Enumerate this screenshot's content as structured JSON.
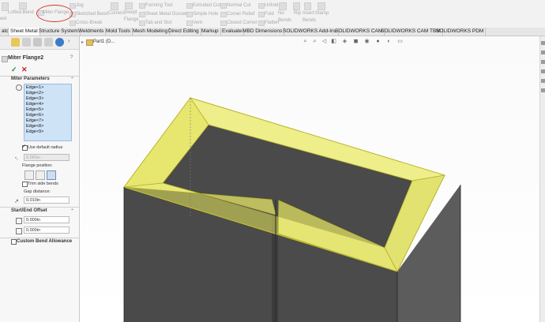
{
  "ribbon": {
    "tools": [
      {
        "id": "base-flange",
        "label": "eet"
      },
      {
        "id": "lofted-bend",
        "label": "Lofted-Bend"
      },
      {
        "id": "miter-flange",
        "label": "Miter Flange"
      },
      {
        "id": "jog",
        "label": "Jog"
      },
      {
        "id": "sketched-bend",
        "label": "Sketched Bend"
      },
      {
        "id": "cross-break",
        "label": "Cross-Break"
      },
      {
        "id": "corners",
        "label": "Corners"
      },
      {
        "id": "swept-flange",
        "label": "Swept Flange"
      },
      {
        "id": "forming-tool",
        "label": "Forming Tool"
      },
      {
        "id": "sheet-metal-gusset",
        "label": "Sheet Metal Gusset"
      },
      {
        "id": "tab-and-slot",
        "label": "Tab and Slot"
      },
      {
        "id": "extruded-cut",
        "label": "Extruded Cut"
      },
      {
        "id": "simple-hole",
        "label": "Simple Hole"
      },
      {
        "id": "vent",
        "label": "Vent"
      },
      {
        "id": "normal-cut",
        "label": "Normal Cut"
      },
      {
        "id": "corner-relief",
        "label": "Corner Relief"
      },
      {
        "id": "closed-corner",
        "label": "Closed Corner"
      },
      {
        "id": "unfold",
        "label": "Unfold"
      },
      {
        "id": "fold",
        "label": "Fold"
      },
      {
        "id": "flatten",
        "label": "Flatten"
      },
      {
        "id": "no-bends",
        "label": "No Bends"
      },
      {
        "id": "rip",
        "label": "Rip"
      },
      {
        "id": "insert-bends",
        "label": "Insert Bends"
      },
      {
        "id": "stamp",
        "label": "Stamp"
      }
    ]
  },
  "tabs": [
    {
      "label": "atch"
    },
    {
      "label": "Sheet Metal"
    },
    {
      "label": "Structure System"
    },
    {
      "label": "Weldments"
    },
    {
      "label": "Mold Tools"
    },
    {
      "label": "Mesh Modeling"
    },
    {
      "label": "Direct Editing"
    },
    {
      "label": "Markup"
    },
    {
      "label": "Evaluate"
    },
    {
      "label": "MBD Dimensions"
    },
    {
      "label": "SOLIDWORKS Add-Ins"
    },
    {
      "label": "SOLIDWORKS CAM"
    },
    {
      "label": "SOLIDWORKS CAM TBM"
    },
    {
      "label": "SOLIDWORKS PDM"
    }
  ],
  "panel": {
    "title": "Miter Flange2",
    "miter_section": "Miter Parameters",
    "edges": [
      "Edge<1>",
      "Edge<2>",
      "Edge<3>",
      "Edge<4>",
      "Edge<5>",
      "Edge<6>",
      "Edge<7>",
      "Edge<8>",
      "Edge<9>"
    ],
    "use_default_radius": "Use default radius",
    "radius_value": "0.065in",
    "flange_position_label": "Flange position:",
    "trim_side_bends": "Trim side bends",
    "gap_distance_label": "Gap distance:",
    "gap_value": "0.010in",
    "start_end_section": "Start/End Offset",
    "start_offset": "0.000in",
    "end_offset": "0.000in",
    "custom_bend_section": "Custom Bend Allowance",
    "ok_symbol": "✓",
    "cancel_symbol": "✕"
  },
  "viewport": {
    "tree_label": "Part1 (D..."
  },
  "colors": {
    "selection_highlight": "#e8e85a",
    "body_dark": "#4a4a4a",
    "body_top": "#5a5a5a",
    "annotation_circle": "#d43030"
  }
}
